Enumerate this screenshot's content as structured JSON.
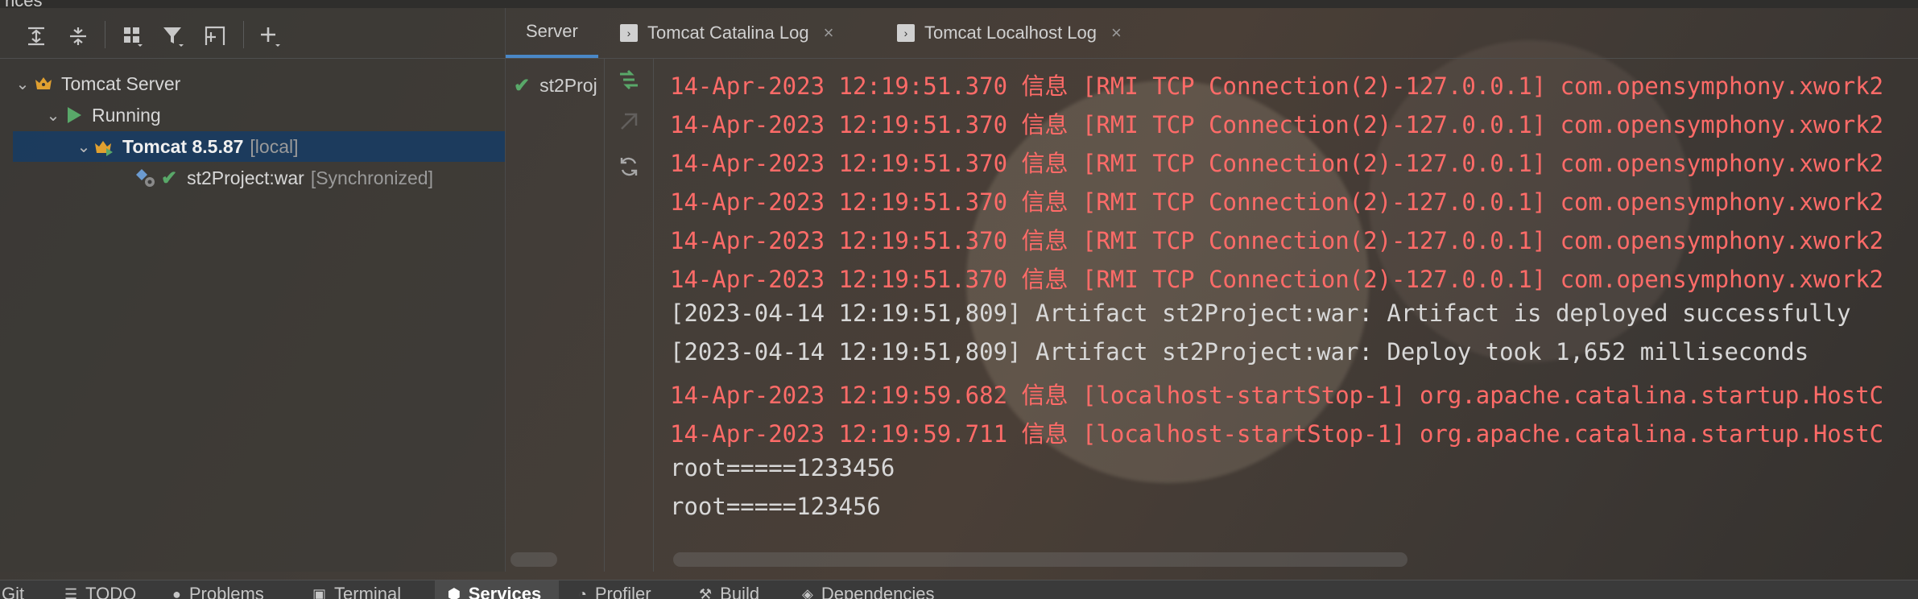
{
  "window_title": "rices",
  "toolbar": {
    "expand_all_icon": "expand-all-icon",
    "collapse_all_icon": "collapse-all-icon",
    "group_icon": "group-icon",
    "filter_icon": "filter-icon",
    "new_tab_icon": "new-tab-icon",
    "add_icon": "add-icon"
  },
  "tree": {
    "root_label": "Tomcat Server",
    "status_label": "Running",
    "server_name": "Tomcat 8.5.87",
    "server_tag": "[local]",
    "artifact_name": "st2Project:war",
    "artifact_status": "[Synchronized]"
  },
  "tabs": [
    {
      "label": "Server"
    },
    {
      "label": "Tomcat Catalina Log"
    },
    {
      "label": "Tomcat Localhost Log"
    }
  ],
  "deployment": {
    "label": "st2Proj"
  },
  "log": [
    {
      "text": "14-Apr-2023 12:19:51.370 信息 [RMI TCP Connection(2)-127.0.0.1] com.opensymphony.xwork2",
      "level": "info"
    },
    {
      "text": "14-Apr-2023 12:19:51.370 信息 [RMI TCP Connection(2)-127.0.0.1] com.opensymphony.xwork2",
      "level": "info"
    },
    {
      "text": "14-Apr-2023 12:19:51.370 信息 [RMI TCP Connection(2)-127.0.0.1] com.opensymphony.xwork2",
      "level": "info"
    },
    {
      "text": "14-Apr-2023 12:19:51.370 信息 [RMI TCP Connection(2)-127.0.0.1] com.opensymphony.xwork2",
      "level": "info"
    },
    {
      "text": "14-Apr-2023 12:19:51.370 信息 [RMI TCP Connection(2)-127.0.0.1] com.opensymphony.xwork2",
      "level": "info"
    },
    {
      "text": "14-Apr-2023 12:19:51.370 信息 [RMI TCP Connection(2)-127.0.0.1] com.opensymphony.xwork2",
      "level": "info"
    },
    {
      "text": "[2023-04-14 12:19:51,809] Artifact st2Project:war: Artifact is deployed successfully",
      "level": "plain"
    },
    {
      "text": "[2023-04-14 12:19:51,809] Artifact st2Project:war: Deploy took 1,652 milliseconds",
      "level": "plain"
    },
    {
      "text": "14-Apr-2023 12:19:59.682 信息 [localhost-startStop-1] org.apache.catalina.startup.HostC",
      "level": "info"
    },
    {
      "text": "14-Apr-2023 12:19:59.711 信息 [localhost-startStop-1] org.apache.catalina.startup.HostC",
      "level": "info"
    },
    {
      "text": "root=====1233456",
      "level": "plain"
    },
    {
      "text": "root=====123456",
      "level": "plain"
    }
  ],
  "bottom_tabs": [
    {
      "label": "Git",
      "icon": "git-icon"
    },
    {
      "label": "TODO",
      "icon": "list-icon"
    },
    {
      "label": "Problems",
      "icon": "problems-icon"
    },
    {
      "label": "Terminal",
      "icon": "terminal-icon"
    },
    {
      "label": "Services",
      "icon": "services-icon",
      "active": true
    },
    {
      "label": "Profiler",
      "icon": "profiler-icon"
    },
    {
      "label": "Build",
      "icon": "build-icon"
    },
    {
      "label": "Dependencies",
      "icon": "dependencies-icon"
    }
  ],
  "colors": {
    "log_info": "#ff6b68",
    "log_plain": "#d8d8d8",
    "selection": "#163c64",
    "running_green": "#59a869"
  }
}
